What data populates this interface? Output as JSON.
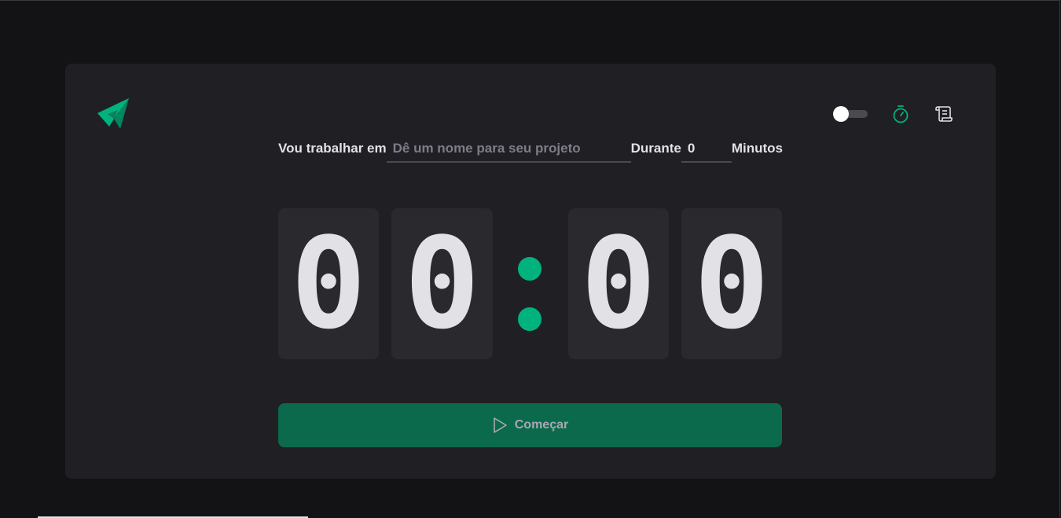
{
  "header": {
    "logo_icon": "paper-plane-logo-icon",
    "theme_toggle": {
      "state": "off"
    },
    "timer_nav_icon": "timer-icon",
    "history_nav_icon": "scroll-icon",
    "accent_color": "#00b37e"
  },
  "form": {
    "task_label": "Vou trabalhar em",
    "task_placeholder": "Dê um nome para seu projeto",
    "task_value": "",
    "duration_label": "Durante",
    "minutes_value": "0",
    "minutes_suffix": "Minutos"
  },
  "countdown": {
    "minutes_tens": "0",
    "minutes_ones": "0",
    "separator": ":",
    "seconds_tens": "0",
    "seconds_ones": "0"
  },
  "start_button": {
    "icon": "play-icon",
    "label": "Começar",
    "color": "#0b6a4b"
  }
}
